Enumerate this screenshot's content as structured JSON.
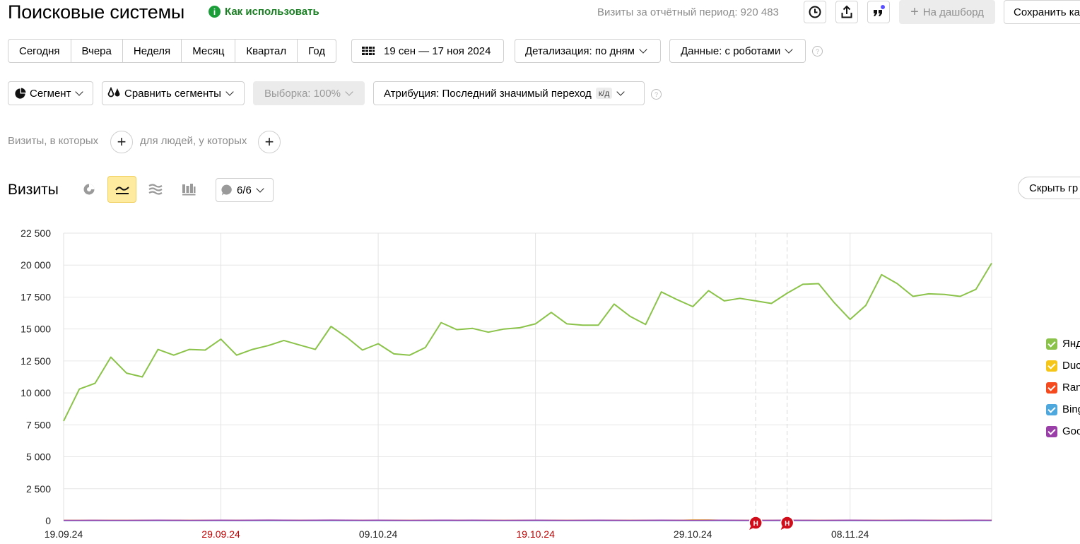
{
  "header": {
    "title": "Поисковые системы",
    "how_to_use": "Как использовать",
    "visits_label": "Визиты за отчётный период: 920 483",
    "to_dashboard": "На дашборд",
    "save": "Сохранить ка"
  },
  "periods": [
    "Сегодня",
    "Вчера",
    "Неделя",
    "Месяц",
    "Квартал",
    "Год"
  ],
  "date_range": "19 сен — 17 ноя 2024",
  "detail": "Детализация: по дням",
  "data_mode": "Данные: с роботами",
  "segment": "Сегмент",
  "compare": "Сравнить сегменты",
  "sample": "Выборка: 100%",
  "attribution": "Атрибуция: Последний значимый переход",
  "attribution_badge": "к/д",
  "conditions": {
    "visits_where": "Визиты, в которых",
    "people_where": "для людей, у которых"
  },
  "visits_section": {
    "title": "Визиты",
    "annotations": "6/6",
    "hide_chart": "Скрыть гр"
  },
  "colors": {
    "yandex": "#8bc34a",
    "duck": "#f5c518",
    "rambler": "#f44a1e",
    "bing": "#4ea8de",
    "google": "#9b3fa8",
    "weekend": "#c00000"
  },
  "legend": [
    {
      "label": "Янд",
      "color": "#8bc34a"
    },
    {
      "label": "Duc",
      "color": "#f5c518"
    },
    {
      "label": "Ran",
      "color": "#f44a1e"
    },
    {
      "label": "Bing",
      "color": "#4ea8de"
    },
    {
      "label": "Goo",
      "color": "#9b3fa8"
    }
  ],
  "markers": [
    "Н",
    "Н"
  ],
  "chart_data": {
    "type": "line",
    "ylim": [
      0,
      22500
    ],
    "yticks": [
      0,
      2500,
      5000,
      7500,
      10000,
      12500,
      15000,
      17500,
      20000,
      22500
    ],
    "ytick_labels": [
      "0",
      "2 500",
      "5 000",
      "7 500",
      "10 000",
      "12 500",
      "15 000",
      "17 500",
      "20 000",
      "22 500"
    ],
    "xtick_labels": [
      "19.09.24",
      "29.09.24",
      "09.10.24",
      "19.10.24",
      "29.10.24",
      "08.11.24"
    ],
    "xtick_weekend": [
      false,
      true,
      false,
      true,
      false,
      false
    ],
    "x": [
      "2024-09-19",
      "2024-09-20",
      "2024-09-21",
      "2024-09-22",
      "2024-09-23",
      "2024-09-24",
      "2024-09-25",
      "2024-09-26",
      "2024-09-27",
      "2024-09-28",
      "2024-09-29",
      "2024-09-30",
      "2024-10-01",
      "2024-10-02",
      "2024-10-03",
      "2024-10-04",
      "2024-10-05",
      "2024-10-06",
      "2024-10-07",
      "2024-10-08",
      "2024-10-09",
      "2024-10-10",
      "2024-10-11",
      "2024-10-12",
      "2024-10-13",
      "2024-10-14",
      "2024-10-15",
      "2024-10-16",
      "2024-10-17",
      "2024-10-18",
      "2024-10-19",
      "2024-10-20",
      "2024-10-21",
      "2024-10-22",
      "2024-10-23",
      "2024-10-24",
      "2024-10-25",
      "2024-10-26",
      "2024-10-27",
      "2024-10-28",
      "2024-10-29",
      "2024-10-30",
      "2024-10-31",
      "2024-11-01",
      "2024-11-02",
      "2024-11-03",
      "2024-11-04",
      "2024-11-05",
      "2024-11-06",
      "2024-11-07",
      "2024-11-08",
      "2024-11-09",
      "2024-11-10",
      "2024-11-11",
      "2024-11-12",
      "2024-11-13",
      "2024-11-14",
      "2024-11-15",
      "2024-11-16",
      "2024-11-17"
    ],
    "series": [
      {
        "key": "yandex",
        "values": [
          7800,
          10300,
          10750,
          12800,
          11550,
          11250,
          13400,
          12950,
          13400,
          13350,
          14200,
          12950,
          13400,
          13700,
          14100,
          13750,
          13400,
          15200,
          14350,
          13350,
          13850,
          13050,
          12950,
          13550,
          15500,
          14950,
          15050,
          14750,
          15000,
          15100,
          15400,
          16300,
          15400,
          15300,
          15300,
          16950,
          16000,
          15350,
          17900,
          17300,
          16750,
          18000,
          17200,
          17400,
          17200,
          17000,
          17800,
          18500,
          18550,
          17050,
          15750,
          16850,
          19250,
          18550,
          17550,
          17750,
          17700,
          17550,
          18100,
          20150
        ]
      },
      {
        "key": "duck",
        "values": [
          20,
          20,
          20,
          20,
          20,
          20,
          20,
          20,
          20,
          20,
          20,
          20,
          20,
          20,
          20,
          20,
          20,
          20,
          20,
          20,
          20,
          20,
          20,
          20,
          20,
          20,
          20,
          20,
          20,
          20,
          20,
          20,
          20,
          20,
          20,
          20,
          20,
          20,
          20,
          20,
          60,
          60,
          20,
          20,
          20,
          20,
          20,
          20,
          20,
          20,
          20,
          20,
          20,
          20,
          20,
          20,
          20,
          20,
          20,
          20
        ]
      },
      {
        "key": "rambler",
        "values": [
          15,
          15,
          15,
          15,
          15,
          15,
          15,
          15,
          15,
          15,
          15,
          15,
          15,
          15,
          15,
          15,
          15,
          15,
          15,
          15,
          15,
          15,
          15,
          15,
          15,
          15,
          15,
          15,
          15,
          15,
          15,
          15,
          15,
          15,
          15,
          15,
          15,
          15,
          15,
          15,
          15,
          15,
          15,
          15,
          15,
          15,
          15,
          15,
          15,
          15,
          15,
          15,
          15,
          15,
          15,
          15,
          15,
          15,
          15,
          15
        ]
      },
      {
        "key": "bing",
        "values": [
          10,
          10,
          10,
          10,
          10,
          10,
          10,
          10,
          10,
          10,
          10,
          10,
          10,
          10,
          10,
          10,
          10,
          10,
          10,
          10,
          10,
          10,
          10,
          10,
          10,
          10,
          10,
          10,
          10,
          10,
          10,
          10,
          10,
          10,
          10,
          10,
          10,
          10,
          10,
          10,
          10,
          10,
          10,
          10,
          10,
          10,
          10,
          10,
          10,
          10,
          10,
          10,
          10,
          10,
          10,
          10,
          10,
          10,
          10,
          10
        ]
      },
      {
        "key": "google",
        "values": [
          30,
          30,
          35,
          30,
          30,
          35,
          40,
          35,
          30,
          35,
          40,
          35,
          40,
          45,
          40,
          35,
          40,
          45,
          40,
          35,
          40,
          35,
          30,
          35,
          40,
          35,
          40,
          35,
          30,
          35,
          40,
          35,
          30,
          35,
          40,
          35,
          30,
          35,
          40,
          35,
          30,
          35,
          40,
          35,
          30,
          35,
          40,
          35,
          30,
          35,
          40,
          35,
          30,
          35,
          40,
          35,
          30,
          35,
          40,
          35
        ]
      }
    ]
  }
}
